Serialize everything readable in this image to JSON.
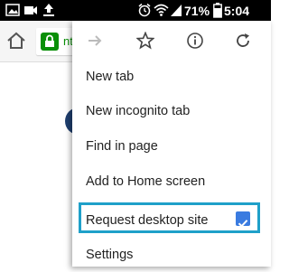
{
  "status_bar": {
    "battery_percent": "71%",
    "time": "5:04 PM",
    "icons": [
      "image-notification-icon",
      "video-notification-icon",
      "upload-icon",
      "alarm-icon",
      "wifi-icon",
      "signal-icon",
      "battery-icon"
    ]
  },
  "toolbar": {
    "url_fragment": "nt",
    "icons": [
      "home-icon",
      "lock-icon"
    ]
  },
  "menu": {
    "top_icons": [
      "forward-icon",
      "bookmark-star-icon",
      "info-icon",
      "refresh-icon"
    ],
    "items": [
      {
        "label": "New tab"
      },
      {
        "label": "New incognito tab"
      },
      {
        "label": "Find in page"
      },
      {
        "label": "Add to Home screen"
      },
      {
        "label": "Request desktop site",
        "checked": true
      },
      {
        "label": "Settings"
      }
    ]
  },
  "colors": {
    "highlight_border": "#1fa0c9",
    "checkbox": "#3a7be0",
    "secure_green": "#0a8f08"
  }
}
